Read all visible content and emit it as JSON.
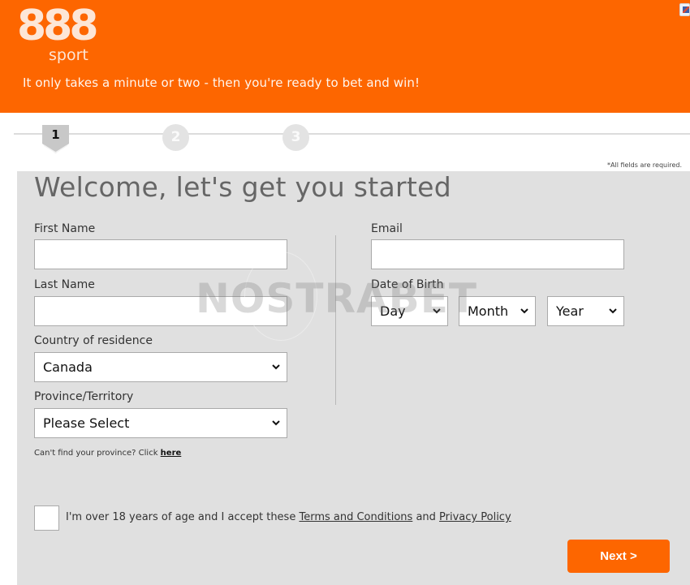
{
  "header": {
    "logo_number": "888",
    "logo_word": "sport",
    "tagline": "It only takes a minute or two - then you're ready to bet and win!",
    "language_icon": "flag-icon"
  },
  "steps": [
    {
      "number": "1",
      "state": "active"
    },
    {
      "number": "2",
      "state": "inactive"
    },
    {
      "number": "3",
      "state": "inactive"
    }
  ],
  "required_note": "*All fields are required.",
  "form": {
    "title": "Welcome, let's get you started",
    "first_name": {
      "label": "First Name",
      "value": ""
    },
    "last_name": {
      "label": "Last Name",
      "value": ""
    },
    "country": {
      "label": "Country of residence",
      "value": "Canada"
    },
    "province": {
      "label": "Province/Territory",
      "value": "Please Select"
    },
    "province_hint": "Can't find your province? Click",
    "province_hint_link": "here",
    "email": {
      "label": "Email",
      "value": ""
    },
    "dob": {
      "label": "Date of Birth",
      "day": "Day",
      "month": "Month",
      "year": "Year"
    },
    "consent": {
      "checked": false,
      "text_before": "I'm over 18 years of age and I accept these",
      "terms_link": "Terms and Conditions",
      "text_and": "and",
      "privacy_link": "Privacy Policy"
    },
    "next_button": "Next >"
  },
  "watermark": "NOSTRABET",
  "colors": {
    "brand_orange": "#fd6600",
    "panel_gray": "#e0e0e0"
  }
}
